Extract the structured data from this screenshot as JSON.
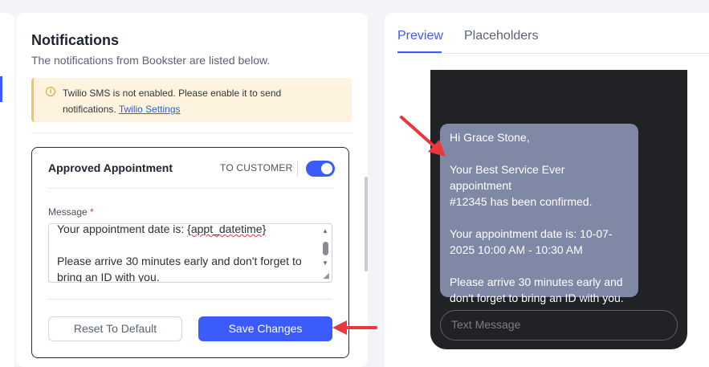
{
  "notifications": {
    "title": "Notifications",
    "subtitle": "The notifications from Bookster are listed below.",
    "alert": {
      "icon": "info-icon",
      "text": "Twilio SMS is not enabled. Please enable it to send notifications.",
      "link": "Twilio Settings",
      "color": "#fdf3de"
    },
    "card": {
      "title": "Approved Appointment",
      "recipient": "TO CUSTOMER",
      "toggle_on": true,
      "message_label": "Message",
      "required_mark": "*",
      "message_lines": [
        "Your appointment date is: {appt_datetime}",
        "",
        "Please arrive 30 minutes early and don't forget to",
        "bring an ID with you."
      ],
      "reset_label": "Reset To Default",
      "save_label": "Save Changes"
    }
  },
  "preview": {
    "tabs": [
      {
        "label": "Preview",
        "active": true
      },
      {
        "label": "Placeholders",
        "active": false
      }
    ],
    "bubble_lines": [
      "Hi Grace Stone,",
      "",
      "Your Best Service Ever appointment",
      "#12345 has been confirmed.",
      "",
      "Your appointment date is: 10-07-",
      "2025 10:00 AM - 10:30 AM",
      "",
      "Please arrive 30 minutes early and",
      "don't forget to bring an ID with you."
    ],
    "sms_placeholder": "Text Message"
  },
  "colors": {
    "accent": "#3b5bfd",
    "annotation_arrow": "#e8373d",
    "phone_bg": "#212226",
    "bubble_bg": "#7f89a6"
  }
}
